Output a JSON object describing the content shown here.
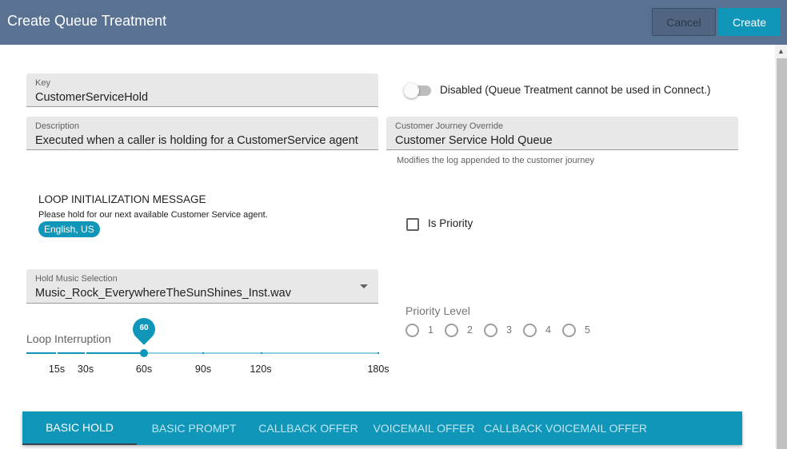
{
  "header": {
    "title": "Create Queue Treatment",
    "cancel_label": "Cancel",
    "create_label": "Create"
  },
  "form": {
    "key": {
      "label": "Key",
      "value": "CustomerServiceHold"
    },
    "disabled_toggle": {
      "label": "Disabled (Queue Treatment cannot be used in Connect.)",
      "on": false
    },
    "description": {
      "label": "Description",
      "value": "Executed when a caller is holding for a CustomerService agent"
    },
    "journey_override": {
      "label": "Customer Journey Override",
      "value": "Customer Service Hold Queue",
      "helper": "Modifies the log appended to the customer journey"
    },
    "loop_init": {
      "title": "LOOP INITIALIZATION MESSAGE",
      "message": "Please hold for our next available Customer Service agent.",
      "language_chip": "English, US"
    },
    "is_priority": {
      "label": "Is Priority",
      "checked": false
    },
    "hold_music": {
      "label": "Hold Music Selection",
      "value": "Music_Rock_EverywhereTheSunShines_Inst.wav"
    },
    "loop_interruption": {
      "label": "Loop Interruption",
      "value": 60,
      "value_label": "60",
      "min": 0,
      "max": 180,
      "ticks": [
        "15s",
        "30s",
        "60s",
        "90s",
        "120s",
        "180s"
      ]
    },
    "priority_level": {
      "label": "Priority Level",
      "options": [
        "1",
        "2",
        "3",
        "4",
        "5"
      ],
      "selected": null
    }
  },
  "tabs": [
    {
      "label": "BASIC HOLD",
      "active": true
    },
    {
      "label": "BASIC PROMPT",
      "active": false
    },
    {
      "label": "CALLBACK OFFER",
      "active": false
    },
    {
      "label": "VOICEMAIL OFFER",
      "active": false
    },
    {
      "label": "CALLBACK VOICEMAIL OFFER",
      "active": false
    }
  ],
  "colors": {
    "header_bg": "#5a7292",
    "accent": "#0f96b9",
    "field_bg": "#e8e8e8"
  },
  "icons": {
    "dropdown": "chevron-down-icon",
    "scroll_up": "arrow-up-icon"
  }
}
